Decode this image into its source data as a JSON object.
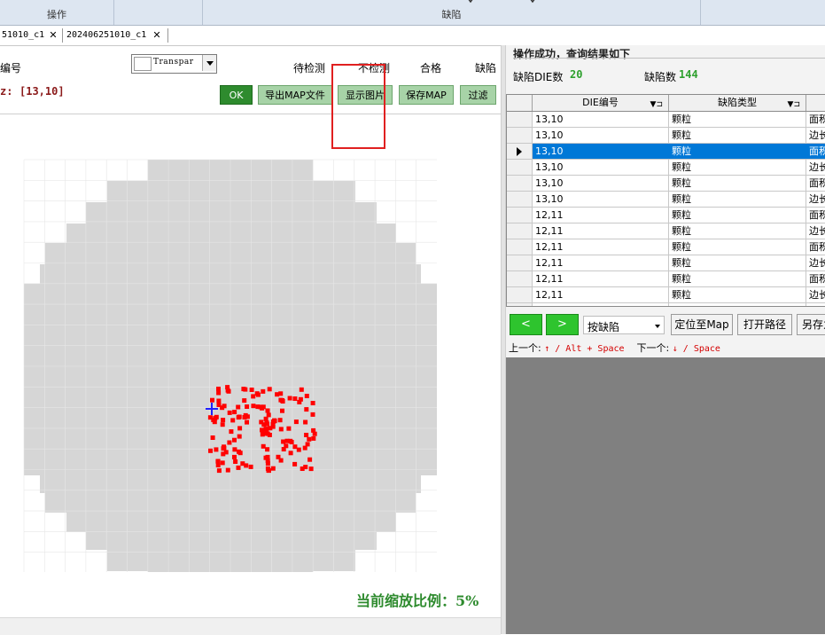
{
  "ribbon": {
    "groups": [
      {
        "label": "操作"
      },
      {
        "label": "缺陷"
      }
    ]
  },
  "tabs": [
    {
      "label": "51010_c1"
    },
    {
      "label": "202406251010_c1"
    }
  ],
  "left": {
    "die_label": "编号",
    "coord_prefix": "z:",
    "coord_value": "[13,10]",
    "color_select": "Transpar",
    "legend": [
      "待检测",
      "不检测",
      "合格",
      "缺陷"
    ],
    "buttons": {
      "ok": "OK",
      "export_map": "导出MAP文件",
      "show_image": "显示图片",
      "save_map": "保存MAP",
      "filter": "过滤"
    },
    "zoom_label": "当前缩放比例：5%"
  },
  "right": {
    "success_message": "操作成功，查询结果如下",
    "defect_die_label": "缺陷DIE数",
    "defect_die_count": "20",
    "defect_count_label": "缺陷数",
    "defect_count": "144",
    "grid": {
      "columns": [
        "DIE编号",
        "缺陷类型"
      ],
      "rows": [
        {
          "die": "13,10",
          "type": "颗粒",
          "extra": "面积"
        },
        {
          "die": "13,10",
          "type": "颗粒",
          "extra": "边长"
        },
        {
          "die": "13,10",
          "type": "颗粒",
          "extra": "面积"
        },
        {
          "die": "13,10",
          "type": "颗粒",
          "extra": "边长"
        },
        {
          "die": "13,10",
          "type": "颗粒",
          "extra": "面积"
        },
        {
          "die": "13,10",
          "type": "颗粒",
          "extra": "边长"
        },
        {
          "die": "12,11",
          "type": "颗粒",
          "extra": "面积"
        },
        {
          "die": "12,11",
          "type": "颗粒",
          "extra": "边长"
        },
        {
          "die": "12,11",
          "type": "颗粒",
          "extra": "面积"
        },
        {
          "die": "12,11",
          "type": "颗粒",
          "extra": "边长"
        },
        {
          "die": "12,11",
          "type": "颗粒",
          "extra": "面积"
        },
        {
          "die": "12,11",
          "type": "颗粒",
          "extra": "边长"
        },
        {
          "die": "12,11",
          "type": "",
          "extra": ""
        }
      ],
      "selected_index": 2
    },
    "nav": {
      "prev": "<",
      "next": ">",
      "mode": "按缺陷",
      "locate_btn": "定位至Map",
      "open_path_btn": "打开路径",
      "save_as_btn": "另存为",
      "hint_prev_label": "上一个:",
      "hint_prev_keys": "↑ / Alt + Space",
      "hint_next_label": "下一个:",
      "hint_next_keys": "↓ / Space"
    }
  },
  "colors": {
    "wafer": "#d6d6d6",
    "defect": "#ff0000",
    "cursor": "#2020ff",
    "green_btn": "#a7d3a7",
    "accent_green": "#2e8b2e",
    "selection": "#0078d7"
  }
}
